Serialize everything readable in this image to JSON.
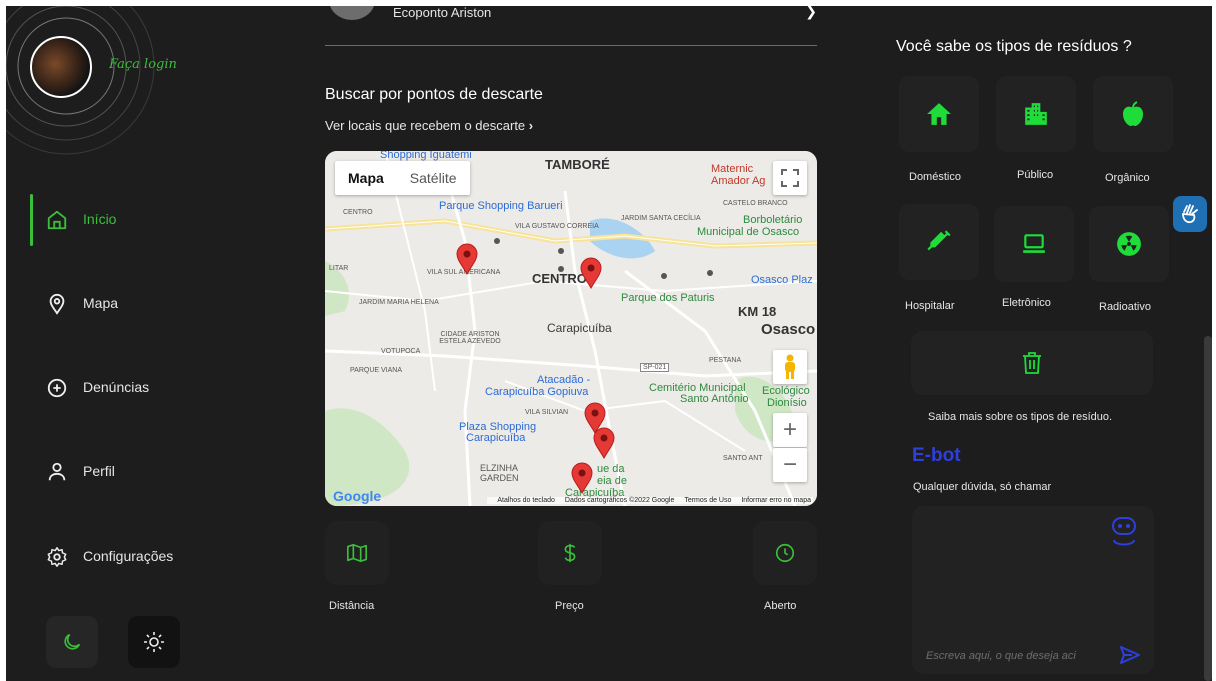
{
  "sidebar": {
    "login_label": "Faça login",
    "nav": [
      {
        "label": "Início",
        "icon": "home-icon",
        "active": true
      },
      {
        "label": "Mapa",
        "icon": "map-pin-icon",
        "active": false
      },
      {
        "label": "Denúncias",
        "icon": "plus-circle-icon",
        "active": false
      },
      {
        "label": "Perfil",
        "icon": "user-icon",
        "active": false
      },
      {
        "label": "Configurações",
        "icon": "gear-icon",
        "active": false
      }
    ],
    "theme": {
      "dark_icon": "moon-icon",
      "light_icon": "sun-icon"
    }
  },
  "center": {
    "top_item": {
      "name": "Ecoponto Ariston"
    },
    "section_title": "Buscar por pontos de descarte",
    "section_link": "Ver locais que recebem o descarte",
    "map": {
      "type_buttons": [
        "Mapa",
        "Satélite"
      ],
      "selected_type": "Mapa",
      "labels": {
        "shopping_iguatemi": "Shopping Iguatemi",
        "tambore": "TAMBORÉ",
        "maternidade": "Maternic",
        "maternidade2": "Amador Ag",
        "parque_barueri": "Parque Shopping Barueri",
        "castelo_branco": "CASTELO BRANCO",
        "centro_small": "CENTRO",
        "jardim_santa_cecilia": "JARDIM SANTA CECÍLIA",
        "borboletario": "Borboletário",
        "municipal_osasco": "Municipal de Osasco",
        "vila_gustavo": "VILA GUSTAVO CORREIA",
        "vila_sul": "VILA SUL AMERICANA",
        "centro": "CENTRO",
        "osasco_plaza": "Osasco Plaz",
        "litar": "LITAR",
        "jardim_maria_helena": "JARDIM MARIA HELENA",
        "parque_paturis": "Parque dos Paturis",
        "km18": "KM 18",
        "carapicuiba": "Carapicuíba",
        "osasco": "Osasco",
        "cidade_ariston": "CIDADE ARISTON ESTELA AZEVEDO",
        "votupoca": "VOTUPOCA",
        "pestana": "PESTANA",
        "parque_viana": "PARQUE VIANA",
        "sp021": "SP-021",
        "atacadao": "Atacadão -",
        "atacadao2": "Carapicuíba Gopiuva",
        "cemiterio": "Cemitério Municipal",
        "cemiterio2": "Santo Antônio",
        "ecologico": "Ecológico",
        "ecologico2": "Dionísio",
        "vila_silviania": "VILA SILVIAN",
        "plaza_shopping": "Plaza Shopping",
        "plaza_shopping2": "Carapicuíba",
        "santo_anto": "SANTO ANT",
        "elzinha": "ELZINHA",
        "garden": "GARDEN",
        "parque_da": "ue da",
        "aldeia": "eia de",
        "carapicuiba3": "Carapicuíba",
        "google": "Google"
      },
      "footer": [
        "Atalhos do teclado",
        "Dados cartográficos ©2022 Google",
        "Termos de Uso",
        "Informar erro no mapa"
      ]
    },
    "filters": [
      {
        "label": "Distância",
        "icon": "map-icon"
      },
      {
        "label": "Preço",
        "icon": "dollar-icon"
      },
      {
        "label": "Aberto",
        "icon": "clock-icon"
      }
    ]
  },
  "right": {
    "title": "Você sabe os tipos de resíduos ?",
    "types": [
      {
        "label": "Doméstico",
        "icon": "house-icon"
      },
      {
        "label": "Público",
        "icon": "city-icon"
      },
      {
        "label": "Orgânico",
        "icon": "apple-icon"
      },
      {
        "label": "Hospitalar",
        "icon": "syringe-icon"
      },
      {
        "label": "Eletrônico",
        "icon": "laptop-icon"
      },
      {
        "label": "Radioativo",
        "icon": "radiation-icon"
      }
    ],
    "trash_icon": "trash-icon",
    "info": "Saiba mais sobre os tipos de resíduo.",
    "ebot": {
      "title": "E-bot",
      "subtitle": "Qualquer dúvida, só chamar",
      "placeholder": "Escreva aqui, o que deseja aci",
      "robot_icon": "robot-icon",
      "send_icon": "send-icon"
    }
  },
  "colors": {
    "accent": "#3bbf3b",
    "ebot": "#2e3fe0",
    "background": "#1d1d1d",
    "tile": "#222222"
  }
}
